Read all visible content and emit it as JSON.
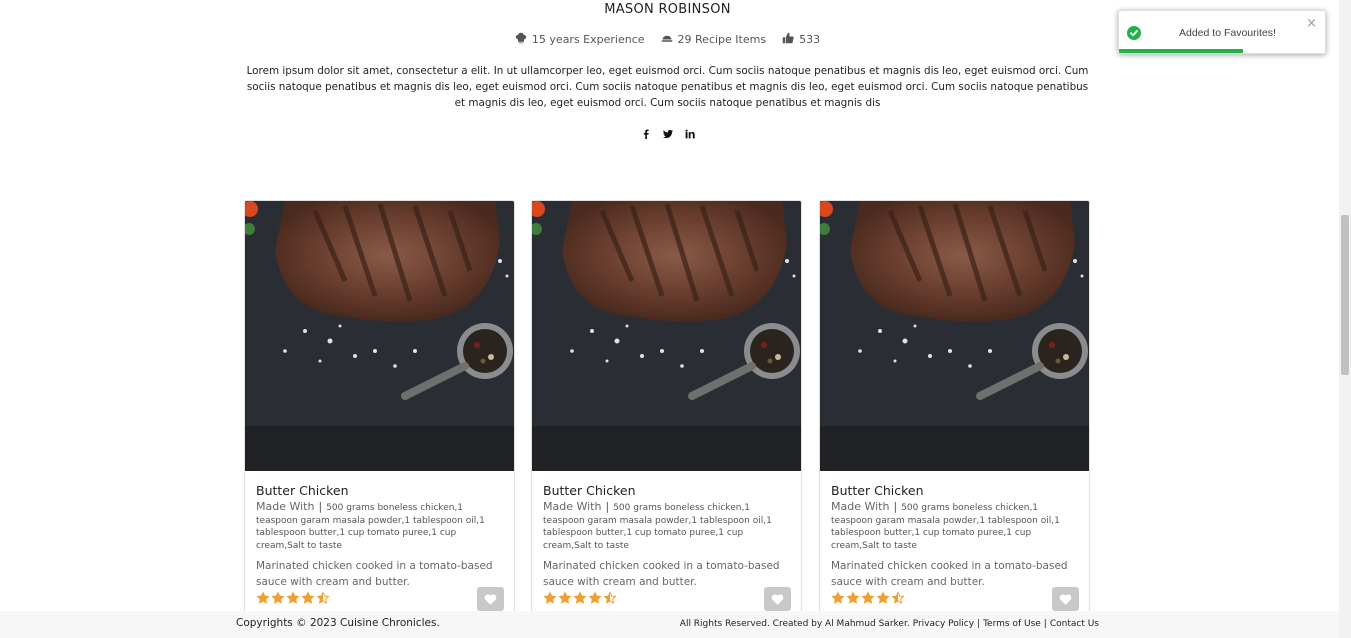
{
  "chef": {
    "name": "MASON ROBINSON",
    "experience": "15 years Experience",
    "recipes": "29 Recipe Items",
    "likes": "533",
    "bio": "Lorem ipsum dolor sit amet, consectetur a elit. In ut ullamcorper leo, eget euismod orci. Cum sociis natoque penatibus et magnis dis leo, eget euismod orci. Cum sociis natoque penatibus et magnis dis leo, eget euismod orci. Cum sociis natoque penatibus et magnis dis leo, eget euismod orci. Cum sociis natoque penatibus et magnis dis leo, eget euismod orci. Cum sociis natoque penatibus et magnis dis"
  },
  "socials": [
    "facebook-icon",
    "twitter-icon",
    "linkedin-icon"
  ],
  "recipes": [
    {
      "title": "Butter Chicken",
      "made_with_label": "Made With",
      "separator": "|",
      "ingredients": "500 grams boneless chicken,1 teaspoon garam masala powder,1 tablespoon oil,1 tablespoon butter,1 cup tomato puree,1 cup cream,Salt to taste",
      "description": "Marinated chicken cooked in a tomato-based sauce with cream and butter.",
      "rating": 4.5
    },
    {
      "title": "Butter Chicken",
      "made_with_label": "Made With",
      "separator": "|",
      "ingredients": "500 grams boneless chicken,1 teaspoon garam masala powder,1 tablespoon oil,1 tablespoon butter,1 cup tomato puree,1 cup cream,Salt to taste",
      "description": "Marinated chicken cooked in a tomato-based sauce with cream and butter.",
      "rating": 4.5
    },
    {
      "title": "Butter Chicken",
      "made_with_label": "Made With",
      "separator": "|",
      "ingredients": "500 grams boneless chicken,1 teaspoon garam masala powder,1 tablespoon oil,1 tablespoon butter,1 cup tomato puree,1 cup cream,Salt to taste",
      "description": "Marinated chicken cooked in a tomato-based sauce with cream and butter.",
      "rating": 4.5
    }
  ],
  "footer": {
    "copyright": "Copyrights © 2023 Cuisine Chronicles.",
    "rights": "All Rights Reserved. Created by Al Mahmud Sarker.",
    "privacy": "Privacy Policy",
    "sep1": "|",
    "terms": "Terms of Use",
    "sep2": "|",
    "contact": "Contact Us"
  },
  "toast": {
    "message": "Added to Favourites!",
    "close": "×",
    "progress": 0.6
  },
  "colors": {
    "star": "#f0a030",
    "toast_success": "#21b24c",
    "fav_button": "#c8c8c8"
  }
}
